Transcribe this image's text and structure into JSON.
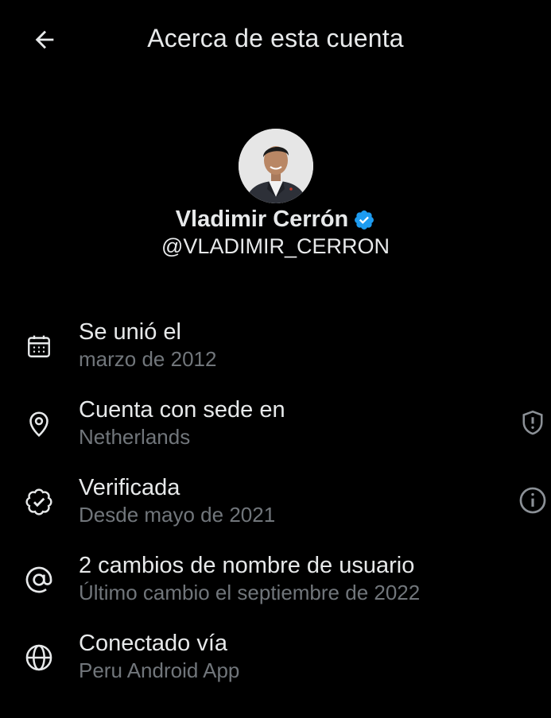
{
  "header": {
    "title": "Acerca de esta cuenta",
    "back_icon": "arrow-left-icon"
  },
  "profile": {
    "name": "Vladimir Cerrón",
    "handle": "@VLADIMIR_CERRON",
    "verified_badge_color": "#1d9bf0",
    "avatar": "profile-photo"
  },
  "info_items": [
    {
      "icon": "calendar-icon",
      "title": "Se unió el",
      "subtitle": "marzo de 2012"
    },
    {
      "icon": "location-pin-icon",
      "title": "Cuenta con sede en",
      "subtitle": "Netherlands",
      "action_icon": "shield-alert-icon"
    },
    {
      "icon": "verified-check-icon",
      "title": "Verificada",
      "subtitle": "Desde mayo de 2021",
      "action_icon": "info-icon"
    },
    {
      "icon": "at-sign-icon",
      "title": "2 cambios de nombre de usuario",
      "subtitle": "Último cambio el septiembre de 2022"
    },
    {
      "icon": "globe-icon",
      "title": "Conectado vía",
      "subtitle": "Peru Android App"
    }
  ],
  "colors": {
    "background": "#000000",
    "primary_text": "#e7e9ea",
    "secondary_text": "#71767b",
    "icon": "#e7e9ea",
    "verified": "#1d9bf0"
  }
}
